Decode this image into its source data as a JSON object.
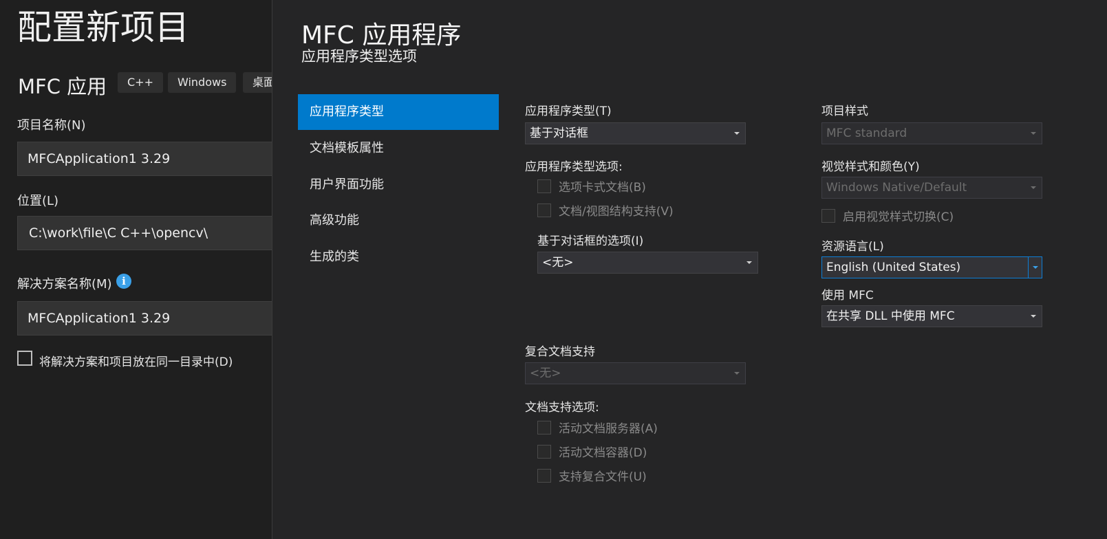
{
  "left_panel": {
    "title": "配置新项目",
    "app_name": "MFC 应用",
    "tags": [
      "C++",
      "Windows",
      "桌面"
    ],
    "project_name_label": "项目名称(N)",
    "project_name_value": "MFCApplication1  3.29",
    "location_label": "位置(L)",
    "location_value": "C:\\work\\file\\C  C++\\opencv\\",
    "solution_name_label": "解决方案名称(M)",
    "info_icon_glyph": "i",
    "solution_name_value": "MFCApplication1  3.29",
    "same_dir_checkbox_label": "将解决方案和项目放在同一目录中(D)",
    "same_dir_checked": false
  },
  "dialog": {
    "title": "MFC 应用程序",
    "subtitle": "应用程序类型选项",
    "nav": [
      {
        "label": "应用程序类型",
        "active": true
      },
      {
        "label": "文档模板属性",
        "active": false
      },
      {
        "label": "用户界面功能",
        "active": false
      },
      {
        "label": "高级功能",
        "active": false
      },
      {
        "label": "生成的类",
        "active": false
      }
    ],
    "app_type_label": "应用程序类型(T)",
    "app_type_value": "基于对话框",
    "app_type_options_label": "应用程序类型选项:",
    "app_type_options": [
      {
        "label": "选项卡式文档(B)",
        "checked": false,
        "enabled": false
      },
      {
        "label": "文档/视图结构支持(V)",
        "checked": false,
        "enabled": false
      }
    ],
    "dialog_options_label": "基于对话框的选项(I)",
    "dialog_options_value": "<无>",
    "compound_doc_label": "复合文档支持",
    "compound_doc_value": "<无>",
    "doc_support_label": "文档支持选项:",
    "doc_support_options": [
      {
        "label": "活动文档服务器(A)",
        "checked": false,
        "enabled": false
      },
      {
        "label": "活动文档容器(D)",
        "checked": false,
        "enabled": false
      },
      {
        "label": "支持复合文件(U)",
        "checked": false,
        "enabled": false
      }
    ],
    "project_style_label": "项目样式",
    "project_style_value": "MFC standard",
    "visual_style_label": "视觉样式和颜色(Y)",
    "visual_style_value": "Windows Native/Default",
    "enable_visual_switch_label": "启用视觉样式切换(C)",
    "resource_lang_label": "资源语言(L)",
    "resource_lang_value": "English (United States)",
    "use_mfc_label": "使用 MFC",
    "use_mfc_value": "在共享 DLL 中使用 MFC"
  },
  "colors": {
    "accent": "#007acc",
    "background": "#252526",
    "left_background": "#1f1f1f",
    "info_icon": "#3aa0e8"
  }
}
